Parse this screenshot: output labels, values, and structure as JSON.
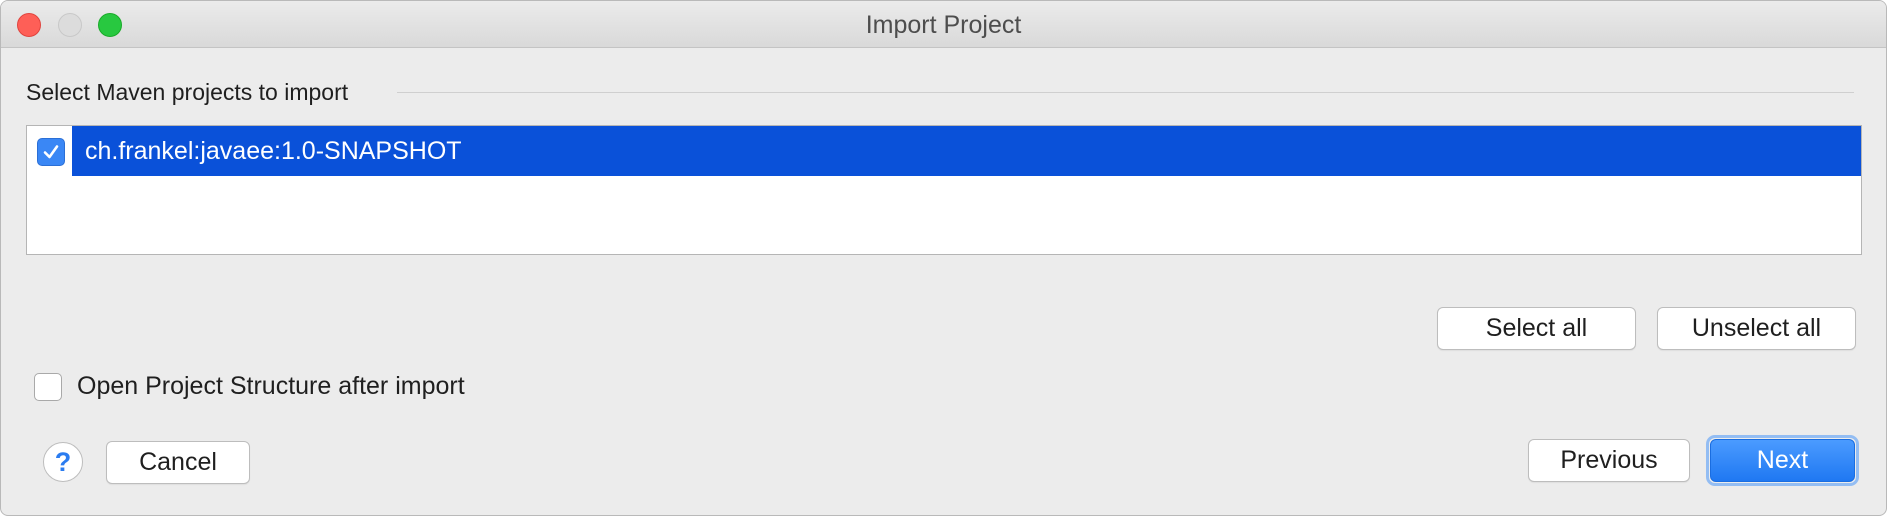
{
  "window": {
    "title": "Import Project"
  },
  "section": {
    "header": "Select Maven projects to import"
  },
  "projects": [
    {
      "label": "ch.frankel:javaee:1.0-SNAPSHOT",
      "checked": true,
      "selected": true
    }
  ],
  "buttons": {
    "select_all": "Select all",
    "unselect_all": "Unselect all",
    "cancel": "Cancel",
    "previous": "Previous",
    "next": "Next",
    "help": "?"
  },
  "options": {
    "open_project_structure": {
      "label": "Open Project Structure after import",
      "checked": false
    }
  },
  "colors": {
    "selection": "#0a51d9",
    "accent": "#1f78f2",
    "close": "#fe5f57",
    "zoom": "#28c840"
  }
}
